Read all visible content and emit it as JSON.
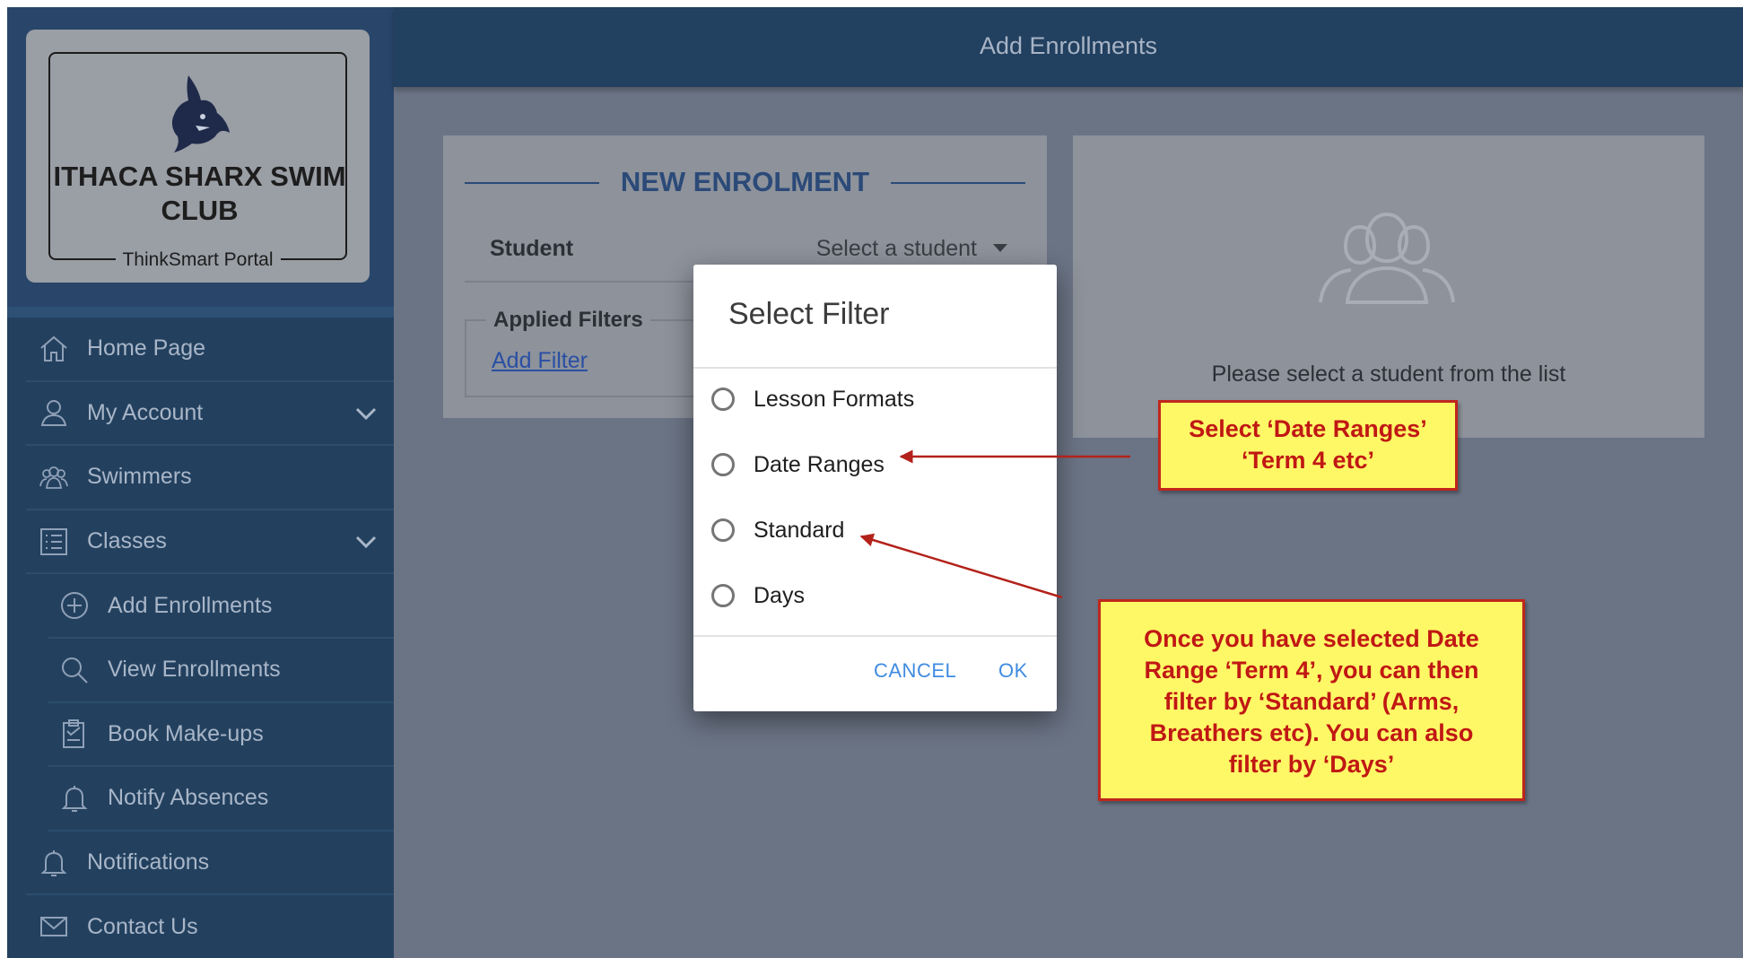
{
  "sidebar": {
    "club_name": "ITHACA SHARX SWIM CLUB",
    "portal_name": "ThinkSmart Portal",
    "nav": [
      {
        "label": "Home Page",
        "icon": "home-icon"
      },
      {
        "label": "My Account",
        "icon": "user-icon",
        "expandable": true
      },
      {
        "label": "Swimmers",
        "icon": "users-icon"
      },
      {
        "label": "Classes",
        "icon": "list-icon",
        "expandable": true
      },
      {
        "label": "Add Enrollments",
        "icon": "plus-circle-icon",
        "sub": true
      },
      {
        "label": "View Enrollments",
        "icon": "search-icon",
        "sub": true
      },
      {
        "label": "Book Make-ups",
        "icon": "clipboard-icon",
        "sub": true
      },
      {
        "label": "Notify Absences",
        "icon": "bell-icon",
        "sub": true
      },
      {
        "label": "Notifications",
        "icon": "bell-icon"
      },
      {
        "label": "Contact Us",
        "icon": "envelope-icon"
      }
    ]
  },
  "header": {
    "title": "Add Enrollments"
  },
  "enrolment": {
    "heading": "NEW ENROLMENT",
    "student_label": "Student",
    "student_placeholder": "Select a student",
    "filters_label": "Applied Filters",
    "add_filter": "Add Filter"
  },
  "student_panel": {
    "message": "Please select a student from the list"
  },
  "dialog": {
    "title": "Select Filter",
    "options": [
      "Lesson Formats",
      "Date Ranges",
      "Standard",
      "Days"
    ],
    "cancel": "CANCEL",
    "ok": "OK"
  },
  "callouts": {
    "first": [
      "Select ‘Date Ranges’",
      "‘Term 4 etc’"
    ],
    "second": [
      "Once you have selected Date",
      "Range ‘Term 4’, you can then",
      "filter by ‘Standard’ (Arms,",
      "Breathers etc). You can also",
      "filter by ‘Days’"
    ]
  },
  "colors": {
    "sidebar": "#23415f",
    "accent_heading": "#2b4a78",
    "dialog_button": "#3f8be0",
    "callout_fill": "#fff866",
    "callout_text": "#c01814"
  }
}
